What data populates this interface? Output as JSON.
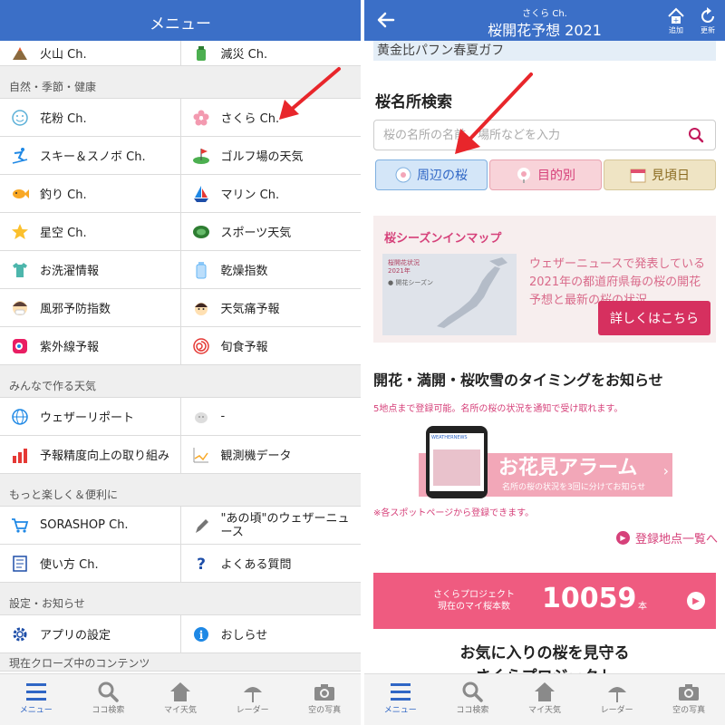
{
  "left": {
    "header": {
      "title": "メニュー"
    },
    "top_row": [
      {
        "icon": "volcano-icon",
        "label": "火山 Ch."
      },
      {
        "icon": "disaster-prevention-icon",
        "label": "減災 Ch."
      }
    ],
    "sections": [
      {
        "title": "自然・季節・健康",
        "rows": [
          [
            {
              "icon": "pollen-icon",
              "label": "花粉 Ch."
            },
            {
              "icon": "sakura-icon",
              "label": "さくら Ch."
            }
          ],
          [
            {
              "icon": "skier-icon",
              "label": "スキー＆スノボ Ch."
            },
            {
              "icon": "golf-icon",
              "label": "ゴルフ場の天気"
            }
          ],
          [
            {
              "icon": "fish-icon",
              "label": "釣り Ch."
            },
            {
              "icon": "sailboat-icon",
              "label": "マリン Ch."
            }
          ],
          [
            {
              "icon": "star-icon",
              "label": "星空 Ch."
            },
            {
              "icon": "stadium-icon",
              "label": "スポーツ天気"
            }
          ],
          [
            {
              "icon": "laundry-shirt-icon",
              "label": "お洗濯情報"
            },
            {
              "icon": "bottle-icon",
              "label": "乾燥指数"
            }
          ],
          [
            {
              "icon": "cold-face-icon",
              "label": "風邪予防指数"
            },
            {
              "icon": "headache-face-icon",
              "label": "天気痛予報"
            }
          ],
          [
            {
              "icon": "uv-icon",
              "label": "紫外線予報"
            },
            {
              "icon": "spiral-icon",
              "label": "旬食予報"
            }
          ]
        ]
      },
      {
        "title": "みんなで作る天気",
        "rows": [
          [
            {
              "icon": "globe-icon",
              "label": "ウェザーリポート"
            },
            {
              "icon": "cloud-icon",
              "label": "-"
            }
          ],
          [
            {
              "icon": "bar-chart-icon",
              "label": "予報精度向上の取り組み"
            },
            {
              "icon": "line-chart-icon",
              "label": "観測機データ"
            }
          ]
        ]
      },
      {
        "title": "もっと楽しく＆便利に",
        "rows": [
          [
            {
              "icon": "cart-icon",
              "label": "SORASHOP Ch."
            },
            {
              "icon": "pen-icon",
              "label": "\"あの頃\"のウェザーニュース"
            }
          ],
          [
            {
              "icon": "manual-icon",
              "label": "使い方 Ch."
            },
            {
              "icon": "question-icon",
              "label": "よくある質問"
            }
          ]
        ]
      },
      {
        "title": "設定・お知らせ",
        "rows": [
          [
            {
              "icon": "gear-icon",
              "label": "アプリの設定"
            },
            {
              "icon": "info-icon",
              "label": "おしらせ"
            }
          ]
        ]
      }
    ],
    "last_section_title": "現在クローズ中のコンテンツ"
  },
  "right": {
    "header": {
      "sub": "さくら Ch.",
      "title": "桜開花予想 2021",
      "add_label": "追加",
      "refresh_label": "更新"
    },
    "top_strip_text": "黄金比パフン春夏ガフ",
    "search_section_title": "桜名所検索",
    "search": {
      "placeholder": "桜の名所の名前、場所などを入力"
    },
    "filters": [
      {
        "label": "周辺の桜",
        "bg": "#d4e6f8",
        "border": "#7fb0e0",
        "color": "#2f66c5",
        "icon": "location-sakura-icon"
      },
      {
        "label": "目的別",
        "bg": "#f8d3d9",
        "border": "#e9a3b0",
        "color": "#d6417a",
        "icon": "purpose-sakura-icon"
      },
      {
        "label": "見頃日",
        "bg": "#efe4c4",
        "border": "#d6c79a",
        "color": "#8a6a1f",
        "icon": "calendar-icon"
      }
    ],
    "season_map": {
      "title": "桜シーズンインマップ",
      "image_label": "桜開花状況\n2021年",
      "image_sub": "● 開花シーズン",
      "desc": "ウェザーニュースで発表している2021年の都道府県毎の桜の開花予想と最新の桜の状況",
      "button": "詳しくはこちら"
    },
    "alarm": {
      "title": "開花・満開・桜吹雪のタイミングをお知らせ",
      "note": "5地点まで登録可能。名所の桜の状況を通知で受け取れます。",
      "banner_title": "お花見アラーム",
      "banner_sub": "名所の桜の状況を3回に分けてお知らせ",
      "phone_label": "WEATHERNEWS",
      "note2": "※各スポットページから登録できます。",
      "link": "登録地点一覧へ"
    },
    "project": {
      "label_line1": "さくらプロジェクト",
      "label_line2": "現在のマイ桜本数",
      "count": "10059",
      "unit": "本"
    },
    "bottom_heading_1": "お気に入りの桜を見守る",
    "bottom_heading_2": "さくらプロジェクト"
  },
  "tabbar": {
    "active_index": 0,
    "items": [
      {
        "icon": "menu-icon",
        "label": "メニュー"
      },
      {
        "icon": "search-icon",
        "label": "ココ検索"
      },
      {
        "icon": "home-icon",
        "label": "マイ天気"
      },
      {
        "icon": "radar-icon",
        "label": "レーダー"
      },
      {
        "icon": "camera-icon",
        "label": "空の写真"
      }
    ]
  },
  "colors": {
    "header_blue": "#3b6fc7",
    "accent_pink": "#d6417a",
    "arrow_red": "#e8262b"
  }
}
